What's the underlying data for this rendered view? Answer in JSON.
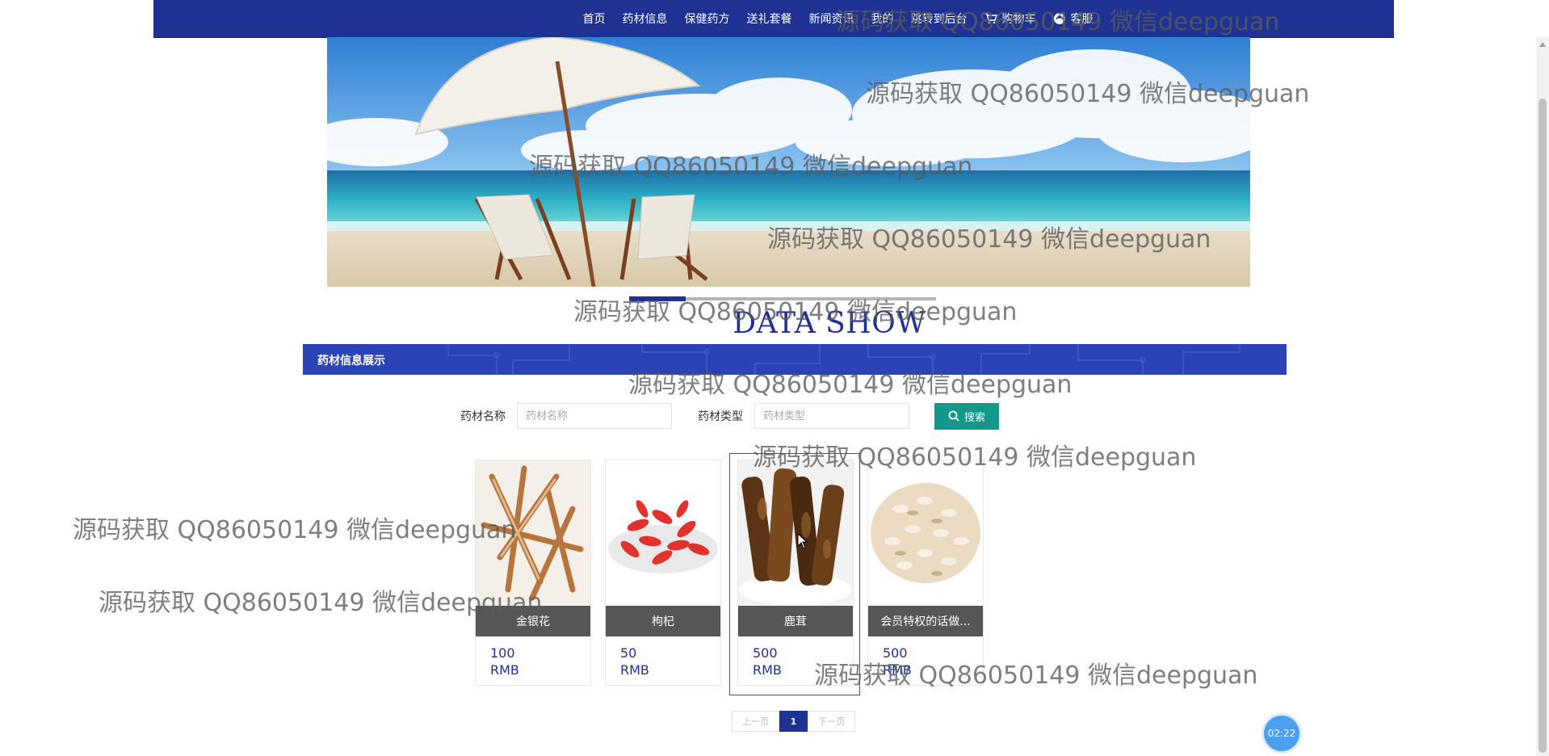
{
  "nav": {
    "items": [
      "首页",
      "药材信息",
      "保健药方",
      "送礼套餐",
      "新闻资讯",
      "我的",
      "跳转到后台",
      "购物车",
      "客服"
    ]
  },
  "section": {
    "title": "DATA SHOW",
    "bar_label": "药材信息展示"
  },
  "search": {
    "name_label": "药材名称",
    "name_placeholder": "药材名称",
    "type_label": "药材类型",
    "type_placeholder": "药材类型",
    "button_label": "搜索"
  },
  "products": [
    {
      "name": "金银花",
      "price": "100",
      "unit": "RMB"
    },
    {
      "name": "枸杞",
      "price": "50",
      "unit": "RMB"
    },
    {
      "name": "鹿茸",
      "price": "500",
      "unit": "RMB"
    },
    {
      "name": "会员特权的话做...",
      "price": "500",
      "unit": "RMB"
    }
  ],
  "pagination": {
    "prev": "上一页",
    "current": "1",
    "next": "下一页"
  },
  "timer": "02:22",
  "watermark": "源码获取 QQ86050149 微信deepguan",
  "colors": {
    "nav_bg": "#1e3294",
    "accent": "#1e3294",
    "search_button": "#14988b",
    "card_label_bg": "#565656"
  }
}
